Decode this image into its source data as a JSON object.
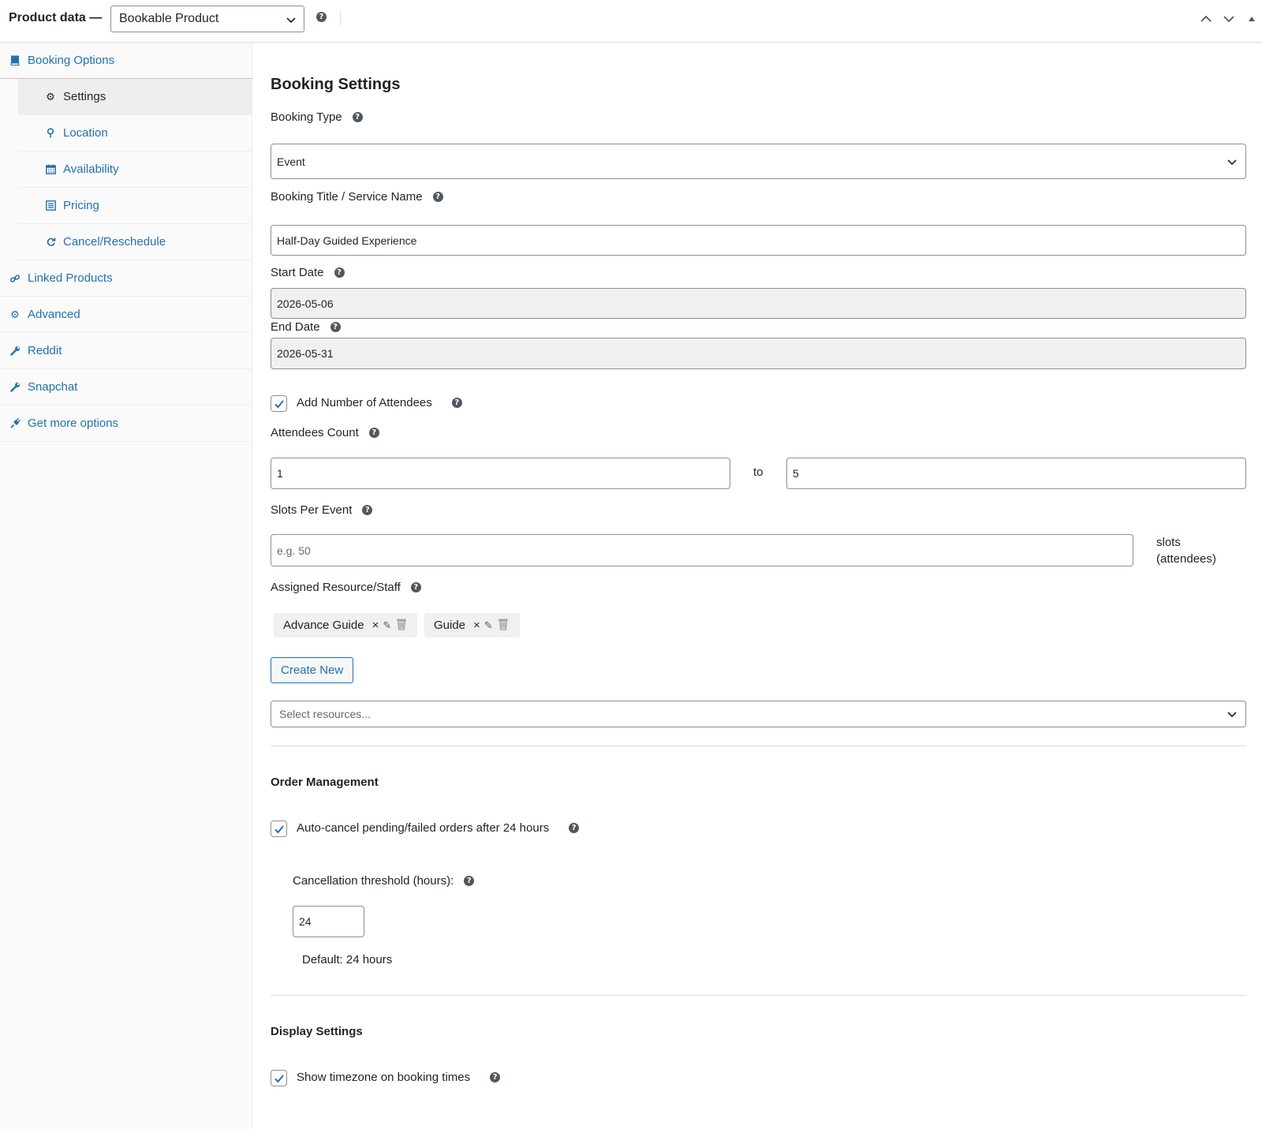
{
  "header": {
    "title": "Product data —",
    "product_type": "Bookable Product"
  },
  "sidebar": {
    "items": [
      {
        "label": "Booking Options",
        "icon": "book-icon"
      },
      {
        "label": "Settings",
        "icon": "gear-icon"
      },
      {
        "label": "Location",
        "icon": "location-pin-icon"
      },
      {
        "label": "Availability",
        "icon": "calendar-icon"
      },
      {
        "label": "Pricing",
        "icon": "list-icon"
      },
      {
        "label": "Cancel/Reschedule",
        "icon": "refresh-icon"
      },
      {
        "label": "Linked Products",
        "icon": "link-icon"
      },
      {
        "label": "Advanced",
        "icon": "gear-icon"
      },
      {
        "label": "Reddit",
        "icon": "wrench-icon"
      },
      {
        "label": "Snapchat",
        "icon": "wrench-icon"
      },
      {
        "label": "Get more options",
        "icon": "plugin-icon"
      }
    ]
  },
  "booking_settings": {
    "title": "Booking Settings",
    "booking_type_label": "Booking Type",
    "booking_type_value": "Event",
    "booking_title_label": "Booking Title / Service Name",
    "booking_title_value": "Half-Day Guided Experience",
    "start_date_label": "Start Date",
    "start_date_value": "2026-05-06",
    "end_date_label": "End Date",
    "end_date_value": "2026-05-31",
    "add_attendees_label": "Add Number of Attendees",
    "attendees_count_label": "Attendees Count",
    "attendees_min": "1",
    "attendees_to": "to",
    "attendees_max": "5",
    "slots_label": "Slots Per Event",
    "slots_placeholder": "e.g. 50",
    "slots_unit_line1": "slots",
    "slots_unit_line2": "(attendees)",
    "resource_label": "Assigned Resource/Staff",
    "resources": [
      {
        "name": "Advance Guide",
        "remove": "×"
      },
      {
        "name": "Guide",
        "remove": "×"
      }
    ],
    "create_new_label": "Create New",
    "select_resources_placeholder": "Select resources..."
  },
  "order_management": {
    "title": "Order Management",
    "auto_cancel_label": "Auto-cancel pending/failed orders after 24 hours",
    "threshold_label": "Cancellation threshold (hours):",
    "threshold_value": "24",
    "default_note": "Default: 24 hours"
  },
  "display_settings": {
    "title": "Display Settings",
    "show_timezone_label": "Show timezone on booking times"
  },
  "colors": {
    "link": "#2271b1",
    "text": "#1d2327",
    "border": "#8c8f94",
    "readonly_bg": "#f0f0f1"
  }
}
